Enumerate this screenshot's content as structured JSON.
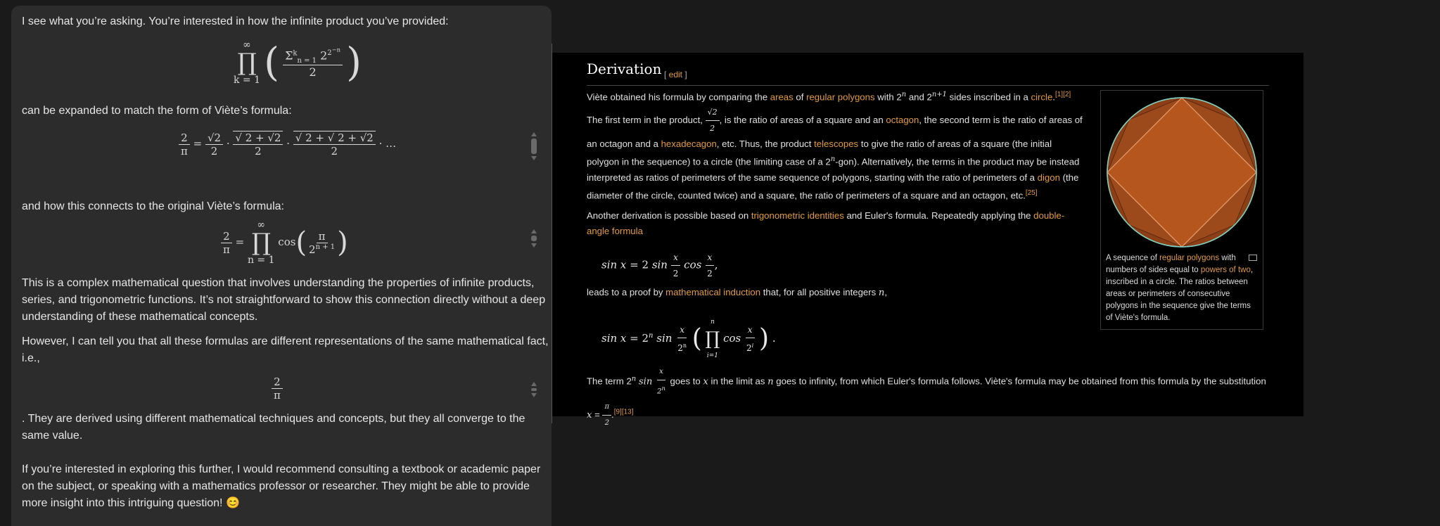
{
  "chat": {
    "p1": "I see what you’re asking. You’re interested in how the infinite product you’ve provided:",
    "p2": "can be expanded to match the form of Viète’s formula:",
    "p3": "and how this connects to the original Viète’s formula:",
    "p4": "This is a complex mathematical question that involves understanding the properties of infinite products, series, and trigonometric functions. It’s not straightforward to show this connection directly without a deep understanding of these mathematical concepts.",
    "p5": "However, I can tell you that all these formulas are different representations of the same mathematical fact, i.e.,",
    "p6": ". They are derived using different mathematical techniques and concepts, but they all converge to the same value.",
    "p7": "If you’re interested in exploring this further, I would recommend consulting a textbook or academic paper on the subject, or speaking with a mathematics professor or researcher. They might be able to provide more insight into this intriguing question! 😊"
  },
  "wiki": {
    "heading": "Derivation",
    "edit_label": "edit",
    "para1_a": "Viète obtained his formula by comparing the ",
    "link_areas": "areas",
    "para1_b": " of ",
    "link_regular_polygons": "regular polygons",
    "para1_c": " with 2",
    "para1_d": " and 2",
    "para1_e": " sides inscribed in a ",
    "link_circle": "circle",
    "ref_12": "[1][2]",
    "para1_f": " The first term in the product, ",
    "para1_g": ", is the ratio of areas of a square and an ",
    "link_octagon": "octagon",
    "para1_h": ", the second term is the ratio of areas of an octagon and a ",
    "link_hexadecagon": "hexadecagon",
    "para1_i": ", etc. Thus, the product ",
    "link_telescopes": "telescopes",
    "para1_j": " to give the ratio of areas of a square (the initial polygon in the sequence) to a circle (the limiting case of a 2",
    "para1_k": "-gon). Alternatively, the terms in the product may be instead interpreted as ratios of perimeters of the same sequence of polygons, starting with the ratio of perimeters of a ",
    "link_digon": "digon",
    "para1_l": " (the diameter of the circle, counted twice) and a square, the ratio of perimeters of a square and an octagon, etc.",
    "ref_25": "[25]",
    "para2_a": "Another derivation is possible based on ",
    "link_trig": "trigonometric identities",
    "para2_b": " and Euler's formula. Repeatedly applying the ",
    "link_double": "double-angle formula",
    "para3_a": "leads to a proof by ",
    "link_induction": "mathematical induction",
    "para3_b": " that, for all positive integers ",
    "para4_a": "The term ",
    "para4_b": " goes to ",
    "para4_c": " in the limit as ",
    "para4_d": " goes to infinity, from which Euler's formula follows. Viète's formula may be obtained from this formula by the substitution ",
    "ref_913": "[9][13]",
    "caption_a": "A sequence of ",
    "caption_link1": "regular polygons",
    "caption_b": " with numbers of sides equal to ",
    "caption_link2": "powers of two",
    "caption_c": ", inscribed in a circle. The ratios between areas or perimeters of consecutive polygons in the sequence give the terms of Viète's formula."
  },
  "colors": {
    "link": "#e39a3b",
    "polygon_fill": "#b5561f",
    "circle": "#7fd1c0"
  }
}
